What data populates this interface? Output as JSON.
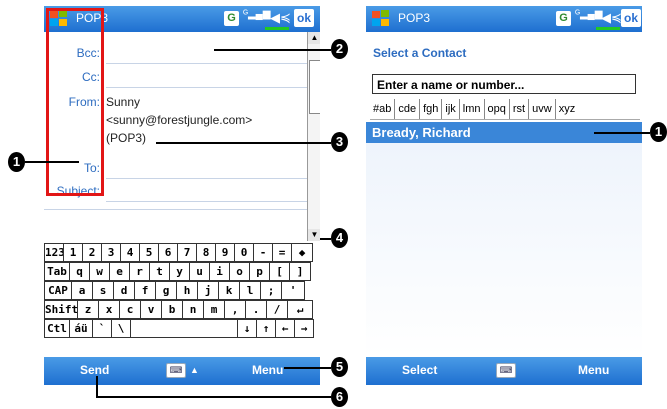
{
  "left_screen": {
    "title": "POP3",
    "fields": {
      "bcc_label": "Bcc:",
      "cc_label": "Cc:",
      "from_label": "From:",
      "from_name": "Sunny",
      "from_email": "<sunny@forestjungle.com>",
      "from_account": "(POP3)",
      "to_label": "To:",
      "subject_label": "Subject:"
    },
    "keyboard_rows": [
      [
        "123",
        "1",
        "2",
        "3",
        "4",
        "5",
        "6",
        "7",
        "8",
        "9",
        "0",
        "-",
        "=",
        "◆"
      ],
      [
        "Tab",
        "q",
        "w",
        "e",
        "r",
        "t",
        "y",
        "u",
        "i",
        "o",
        "p",
        "[",
        "]"
      ],
      [
        "CAP",
        "a",
        "s",
        "d",
        "f",
        "g",
        "h",
        "j",
        "k",
        "l",
        ";",
        "'"
      ],
      [
        "Shift",
        "z",
        "x",
        "c",
        "v",
        "b",
        "n",
        "m",
        ",",
        ".",
        "/",
        "↵"
      ],
      [
        "Ctl",
        "áü",
        "`",
        "\\",
        "",
        "↓",
        "↑",
        "←",
        "→"
      ]
    ],
    "softkeys": {
      "left": "Send",
      "right": "Menu"
    }
  },
  "right_screen": {
    "title": "POP3",
    "heading": "Select a Contact",
    "search_placeholder": "Enter a name or number...",
    "alpha_tabs": [
      "#ab",
      "cde",
      "fgh",
      "ijk",
      "lmn",
      "opq",
      "rst",
      "uvw",
      "xyz"
    ],
    "selected_contact": "Bready, Richard",
    "softkeys": {
      "left": "Select",
      "right": "Menu"
    }
  },
  "callouts": {
    "c1_left": "1",
    "c2": "2",
    "c3": "3",
    "c4": "4",
    "c5": "5",
    "c6": "6",
    "c1_right": "1"
  },
  "colors": {
    "titlebar": "#1e6fd0",
    "label_blue": "#2d6cc0",
    "highlight": "#3a86d8",
    "red_box": "#e21616",
    "battery": "#22c922"
  }
}
